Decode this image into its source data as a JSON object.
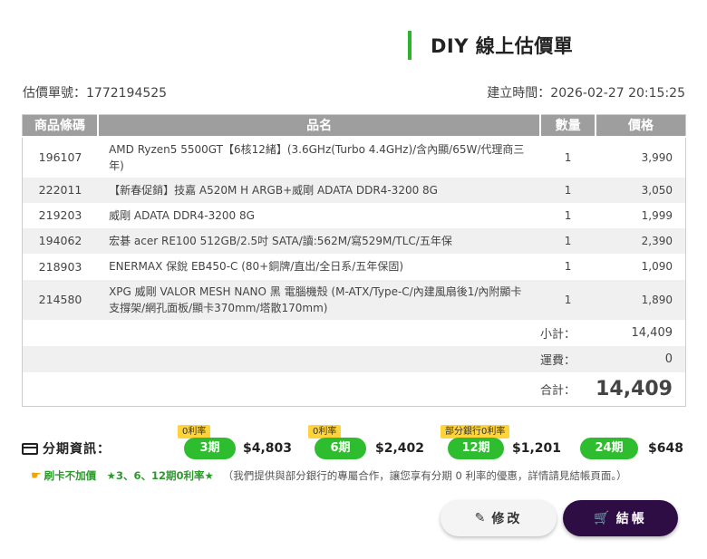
{
  "header": {
    "title": "DIY 線上估價單"
  },
  "meta": {
    "quote_no": "估價單號：1772194525",
    "created": "建立時間：2026-02-27 20:15:25"
  },
  "table": {
    "headers": {
      "code": "商品條碼",
      "name": "品名",
      "qty": "數量",
      "price": "價格"
    },
    "rows": [
      {
        "code": "196107",
        "name": "AMD Ryzen5 5500GT【6核12緒】(3.6GHz(Turbo 4.4GHz)/含內顯/65W/代理商三年)",
        "qty": "1",
        "price": "3,990"
      },
      {
        "code": "222011",
        "name": "【新春促銷】技嘉 A520M H ARGB+威剛 ADATA DDR4-3200 8G",
        "qty": "1",
        "price": "3,050"
      },
      {
        "code": "219203",
        "name": "威剛 ADATA DDR4-3200 8G",
        "qty": "1",
        "price": "1,999"
      },
      {
        "code": "194062",
        "name": "宏碁 acer RE100 512GB/2.5吋 SATA/讀:562M/寫529M/TLC/五年保",
        "qty": "1",
        "price": "2,390"
      },
      {
        "code": "218903",
        "name": "ENERMAX 保銳 EB450-C (80+銅牌/直出/全日系/五年保固)",
        "qty": "1",
        "price": "1,090"
      },
      {
        "code": "214580",
        "name": "XPG 威剛 VALOR MESH NANO 黑 電腦機殼 (M-ATX/Type-C/內建風扇後1/內附顯卡支撐架/網孔面板/顯卡370mm/塔散170mm)",
        "qty": "1",
        "price": "1,890"
      }
    ],
    "subtotal_label": "小計：",
    "subtotal": "14,409",
    "shipping_label": "運費：",
    "shipping": "0",
    "total_label": "合計：",
    "total": "14,409"
  },
  "installments": {
    "title": "分期資訊：",
    "plans": [
      {
        "badge": "0利率",
        "term": "3期",
        "amount": "$4,803"
      },
      {
        "badge": "0利率",
        "term": "6期",
        "amount": "$2,402"
      },
      {
        "badge": "部分銀行0利率",
        "term": "12期",
        "amount": "$1,201"
      },
      {
        "badge": "",
        "term": "24期",
        "amount": "$648"
      }
    ]
  },
  "note": {
    "highlight": "刷卡不加價　★3、6、12期0利率★",
    "text": "（我們提供與部分銀行的專屬合作，讓您享有分期 0 利率的優惠，詳情請見結帳頁面。）"
  },
  "buttons": {
    "edit": "修改",
    "checkout": "結帳"
  },
  "colors": {
    "accent_green": "#2ebd2e",
    "price_red": "#e53935",
    "checkout_bg": "#2e0d45",
    "badge_yellow": "#ffd43b"
  }
}
